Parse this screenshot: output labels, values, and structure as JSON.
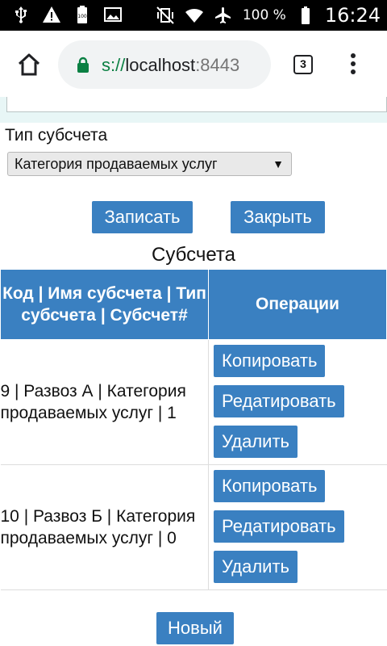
{
  "status_bar": {
    "battery_percent": "100 %",
    "time": "16:24",
    "left_icons": [
      "usb-icon",
      "warning-icon",
      "battery-full-icon",
      "image-icon"
    ],
    "right_icons": [
      "vibrate-off-icon",
      "wifi-icon",
      "airplane-icon",
      "battery-icon"
    ]
  },
  "browser": {
    "url_scheme_part": "s://",
    "url_host": "localhost",
    "url_port": ":8443",
    "tab_count": "3"
  },
  "form": {
    "subaccount_type_label": "Тип субсчета",
    "subaccount_type_value": "Категория продаваемых услуг",
    "save_label": "Записать",
    "close_label": "Закрыть"
  },
  "table": {
    "title": "Субсчета",
    "header_col1": "Код | Имя субсчета | Тип субсчета | Субсчет#",
    "header_col2": "Операции",
    "rows": [
      {
        "desc": "9 | Развоз А | Категория продаваемых услуг | 1",
        "copy": "Копировать",
        "edit": "Редатировать",
        "delete": "Удалить"
      },
      {
        "desc": "10 | Развоз Б | Категория продаваемых услуг | 0",
        "copy": "Копировать",
        "edit": "Редатировать",
        "delete": "Удалить"
      }
    ],
    "new_label": "Новый"
  },
  "colors": {
    "accent": "#3a80c1",
    "status_bar": "#000000",
    "url_secure": "#0b8043"
  }
}
